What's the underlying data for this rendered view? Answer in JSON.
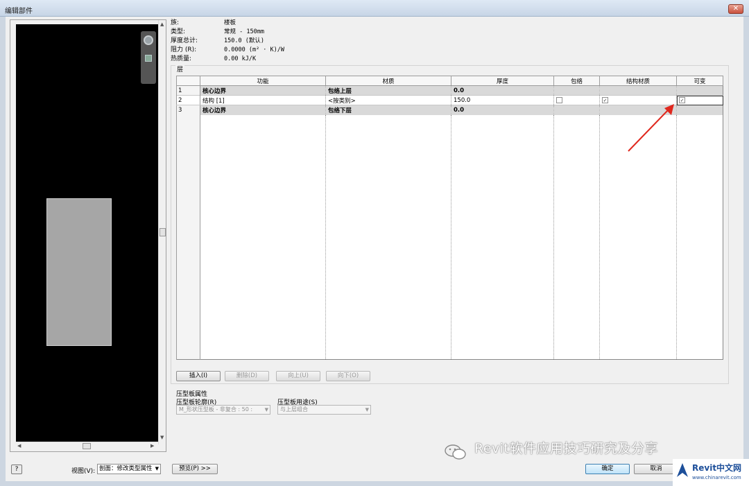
{
  "window": {
    "title": "编辑部件",
    "close_glyph": "✕"
  },
  "properties": [
    {
      "key": "族:",
      "value": "楼板"
    },
    {
      "key": "类型:",
      "value": "常规 - 150mm"
    },
    {
      "key": "厚度总计:",
      "value": "150.0 (默认)"
    },
    {
      "key": "阻力 (R):",
      "value": "0.0000 (m² · K)/W"
    },
    {
      "key": "热质量:",
      "value": "0.00 kJ/K"
    }
  ],
  "layers": {
    "group_label": "层",
    "columns": [
      "",
      "功能",
      "材质",
      "厚度",
      "包络",
      "结构材质",
      "可变"
    ],
    "rows": [
      {
        "n": "1",
        "function": "核心边界",
        "material": "包络上层",
        "thickness": "0.0",
        "wraps": "",
        "structural": "",
        "variable": ""
      },
      {
        "n": "2",
        "function": "结构 [1]",
        "material": "<按类别>",
        "thickness": "150.0",
        "wraps": "unchecked",
        "structural": "checked",
        "variable": "checked"
      },
      {
        "n": "3",
        "function": "核心边界",
        "material": "包络下层",
        "thickness": "0.0",
        "wraps": "",
        "structural": "",
        "variable": ""
      }
    ],
    "buttons": {
      "insert": "插入(I)",
      "delete": "删除(D)",
      "up": "向上(U)",
      "down": "向下(O)"
    }
  },
  "deck": {
    "title": "压型板属性",
    "profile_label": "压型板轮廓(R)",
    "profile_value": "M_形状压型板 - 非复合 : 50 :",
    "usage_label": "压型板用途(S)",
    "usage_value": "与上层组合"
  },
  "bottom": {
    "help_glyph": "?",
    "view_label": "视图(V):",
    "view_value": "剖面：修改类型属性",
    "preview_button": "预览(P) >>",
    "ok_button": "确定",
    "cancel_button": "取消"
  },
  "watermark": {
    "text": "Revit软件应用技巧研究及分享"
  },
  "logo": {
    "brand": "Revit中文网",
    "url": "www.chinarevit.com"
  },
  "colors": {
    "annotation_arrow": "#e0281e",
    "core_row": "#d9d9d9",
    "preview_bg": "#000000",
    "preview_section": "#a6a6a6"
  }
}
